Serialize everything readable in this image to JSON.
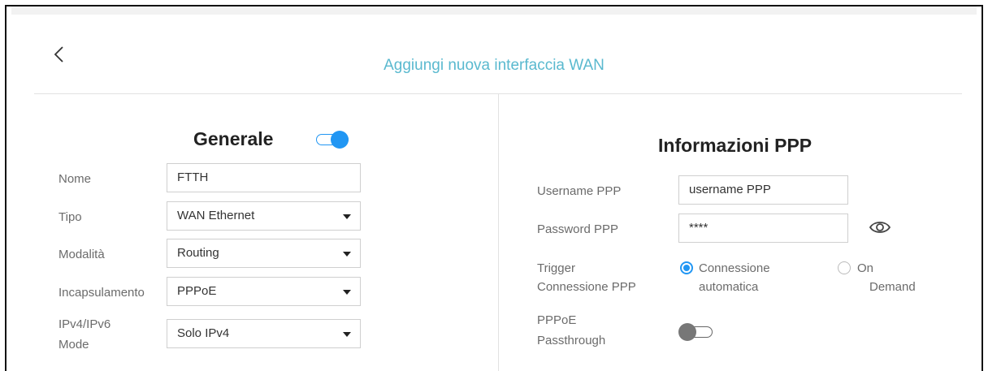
{
  "header": {
    "title": "Aggiungi nuova interfaccia WAN"
  },
  "generale": {
    "title": "Generale",
    "enabled": true,
    "fields": [
      {
        "label": "Nome",
        "value": "FTTH"
      },
      {
        "label": "Tipo",
        "value": "WAN Ethernet"
      },
      {
        "label": "Modalità",
        "value": "Routing"
      },
      {
        "label": "Incapsulamento",
        "value": "PPPoE"
      },
      {
        "label_line1": "IPv4/IPv6",
        "label_line2": "Mode",
        "value": "Solo IPv4"
      }
    ]
  },
  "ppp": {
    "title": "Informazioni PPP",
    "username_label": "Username PPP",
    "username_value": "username PPP",
    "password_label": "Password PPP",
    "password_value": "****",
    "trigger_label_line1": "Trigger",
    "trigger_label_line2": "Connessione PPP",
    "trigger_options": [
      {
        "line1": "Connessione",
        "line2": "automatica",
        "selected": true
      },
      {
        "line1": "On",
        "line2": "Demand",
        "selected": false
      }
    ],
    "passthrough_label_line1": "PPPoE",
    "passthrough_label_line2": "Passthrough",
    "passthrough_enabled": false
  },
  "colors": {
    "accent": "#2196f3",
    "title": "#5ab9cf"
  },
  "icons": {
    "back": "chevron-left-icon",
    "show_password": "eye-icon"
  }
}
